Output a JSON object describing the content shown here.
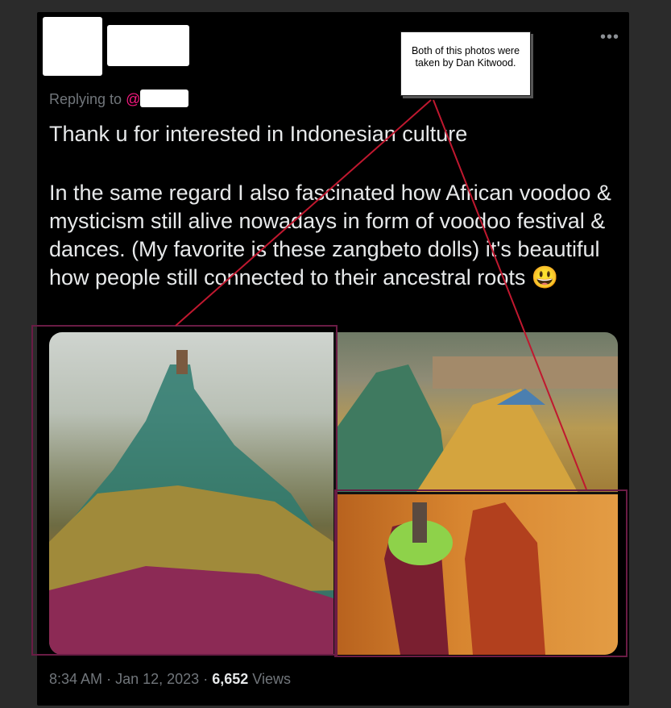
{
  "tweet": {
    "replying_label": "Replying to",
    "replying_handle": "@",
    "paragraph1": "Thank u for interested in Indonesian culture",
    "paragraph2": "In the same regard I also fascinated how African voodoo & mysticism still alive nowadays in form of voodoo festival & dances. (My favorite is these zangbeto dolls) it's beautiful how people still connected to their ancestral roots 😃",
    "time": "8:34 AM",
    "date": "Jan 12, 2023",
    "views_count": "6,652",
    "views_label": "Views",
    "separator": "·"
  },
  "annotation": {
    "note_text": "Both of this photos were taken by Dan Kitwood."
  },
  "icons": {
    "more": "more-icon"
  },
  "colors": {
    "background": "#000000",
    "text": "#e7e9ea",
    "muted": "#71767b",
    "mention": "#f91880",
    "annotation_line": "#c0182f",
    "highlight_box": "#6a1c45"
  }
}
